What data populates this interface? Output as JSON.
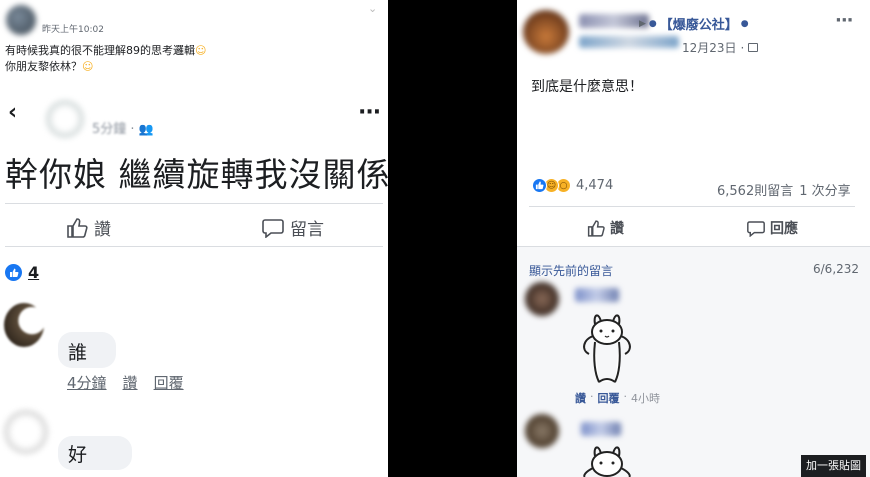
{
  "left": {
    "header": {
      "timestamp": "昨天上午10:02",
      "line1": "有時候我真的很不能理解89的思考邏輯",
      "line2": "你朋友黎依林？"
    },
    "post": {
      "time": "5分鐘",
      "text": "幹你娘 繼續旋轉我沒關係"
    },
    "actions": {
      "like": "讚",
      "comment": "留言"
    },
    "reactions": {
      "count": "4"
    },
    "comments": [
      {
        "text": "誰",
        "time": "4分鐘",
        "like": "讚",
        "reply": "回覆"
      },
      {
        "text": "好"
      }
    ]
  },
  "right": {
    "header": {
      "group": "【爆廢公社】",
      "date": "12月23日"
    },
    "post": {
      "text": "到底是什麼意思！"
    },
    "stats": {
      "reactions": "4,474",
      "comments": "6,562則留言",
      "shares": "1 次分享"
    },
    "actions": {
      "like": "讚",
      "comment": "回應"
    },
    "comments_header": {
      "show_previous": "顯示先前的留言",
      "count": "6/6,232"
    },
    "comment1": {
      "like": "讚",
      "reply": "回覆",
      "time": "4小時"
    }
  },
  "watermark": "加一張貼圖",
  "colors": {
    "like_blue": "#1877f2",
    "link_blue": "#385898",
    "haha_yellow": "#f7b125",
    "text": "#1c1e21",
    "muted": "#606770"
  }
}
